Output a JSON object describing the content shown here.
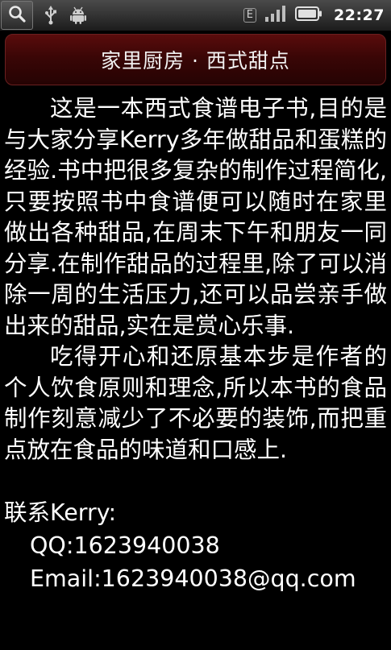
{
  "status_bar": {
    "time": "22:27",
    "network_badge": "E",
    "icons": [
      "search-icon",
      "usb-icon",
      "android-icon",
      "signal-icon",
      "battery-icon"
    ]
  },
  "header": {
    "title": "家里厨房 · 西式甜点"
  },
  "content": {
    "paragraphs": [
      "这是一本西式食谱电子书,目的是与大家分享Kerry多年做甜品和蛋糕的经验.书中把很多复杂的制作过程简化,只要按照书中食谱便可以随时在家里做出各种甜品,在周末下午和朋友一同分享.在制作甜品的过程里,除了可以消除一周的生活压力,还可以品尝亲手做出来的甜品,实在是赏心乐事.",
      "吃得开心和还原基本步是作者的个人饮食原则和理念,所以本书的食品制作刻意减少了不必要的装饰,而把重点放在食品的味道和口感上."
    ],
    "contact": {
      "heading": "联系Kerry:",
      "qq": "QQ:1623940038",
      "email": "Email:1623940038@qq.com"
    }
  },
  "colors": {
    "background": "#000000",
    "title_bar": "#3a0606",
    "text": "#ffffff"
  }
}
